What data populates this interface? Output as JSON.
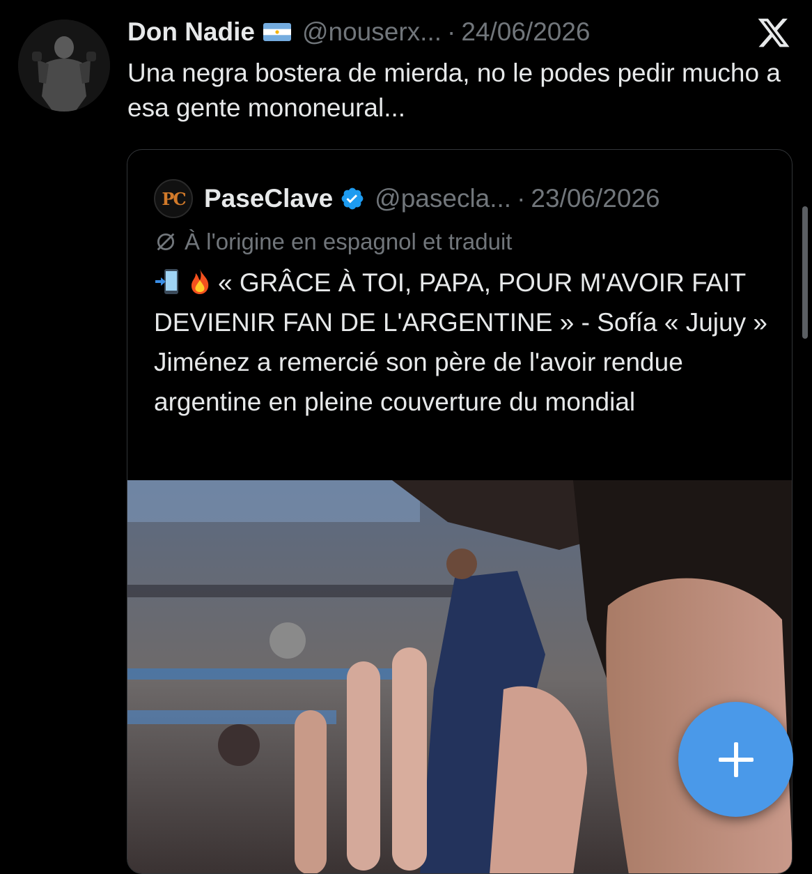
{
  "tweet": {
    "display_name": "Don Nadie",
    "flag_icon": "argentina-flag-icon",
    "handle": "@nouserx...",
    "separator": "·",
    "date": "24/06/2026",
    "text": "Una negra bostera de mierda, no le podes pedir mucho a esa gente mononeural..."
  },
  "quoted": {
    "avatar_text": "PC",
    "display_name": "PaseClave",
    "verified_icon": "verified-badge-icon",
    "handle": "@pasecla...",
    "separator": "·",
    "date": "23/06/2026",
    "translated_label": "À l'origine en espagnol et traduit",
    "emojis": [
      "mobile-phone-arrow-emoji",
      "fire-emoji"
    ],
    "text": "« GRÂCE À TOI, PAPA, POUR M'AVOIR FAIT DEVIENIR FAN DE L'ARGENTINE » - Sofía « Jujuy » Jiménez a remercié son père de l'avoir rendue argentine en pleine couverture du mondial",
    "media_type": "video-thumbnail"
  },
  "colors": {
    "background": "#000000",
    "text_primary": "#e7e9ea",
    "text_secondary": "#71767b",
    "border": "#333639",
    "verified_blue": "#1d9bf0",
    "fab_blue": "#4a99e9"
  },
  "fab": {
    "icon": "plus-icon"
  },
  "brand": {
    "icon": "x-logo-icon"
  }
}
